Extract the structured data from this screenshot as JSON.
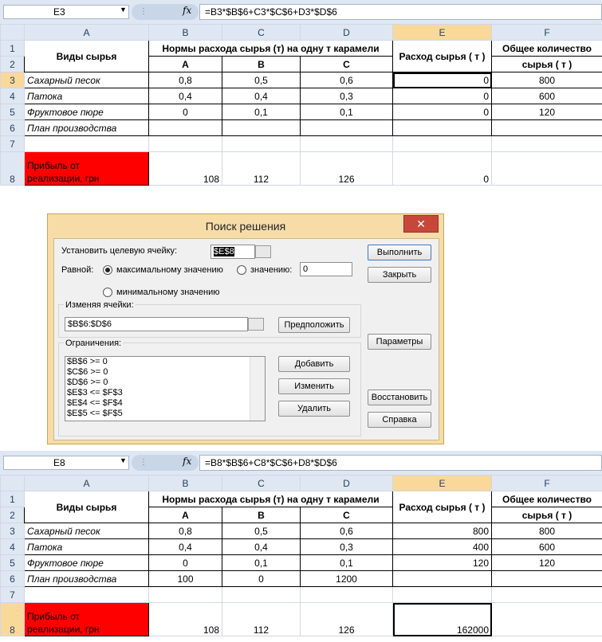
{
  "top": {
    "namebox": "E3",
    "fx": "fx",
    "formula": "=B3*$B$6+C3*$C$6+D3*$D$6"
  },
  "bottom": {
    "namebox": "E8",
    "fx": "fx",
    "formula": "=B8*$B$6+C8*$C$6+D8*$D$6"
  },
  "columns": [
    "A",
    "B",
    "C",
    "D",
    "E",
    "F"
  ],
  "rows": [
    "1",
    "2",
    "3",
    "4",
    "5",
    "6",
    "7",
    "8"
  ],
  "table": {
    "h_types": "Виды сырья",
    "h_norms": "Нормы расхода сырья (т) на одну т карамели",
    "h_a": "A",
    "h_b": "B",
    "h_c": "C",
    "h_usage": "Расход сырья ( т )",
    "h_total1": "Общее количество",
    "h_total2": "сырья ( т )",
    "r3": "Сахарный песок",
    "r4": "Патока",
    "r5": "Фруктовое пюре",
    "r6": "План производства",
    "r8a": "Прибыль от",
    "r8b": "реализации, грн"
  },
  "sheet1": {
    "b3": "0,8",
    "c3": "0,5",
    "d3": "0,6",
    "e3": "0",
    "f3": "800",
    "b4": "0,4",
    "c4": "0,4",
    "d4": "0,3",
    "e4": "0",
    "f4": "600",
    "b5": "0",
    "c5": "0,1",
    "d5": "0,1",
    "e5": "0",
    "f5": "120",
    "b6": "",
    "c6": "",
    "d6": "",
    "b8": "108",
    "c8": "112",
    "d8": "126",
    "e8": "0"
  },
  "sheet2": {
    "b3": "0,8",
    "c3": "0,5",
    "d3": "0,6",
    "e3": "800",
    "f3": "800",
    "b4": "0,4",
    "c4": "0,4",
    "d4": "0,3",
    "e4": "400",
    "f4": "600",
    "b5": "0",
    "c5": "0,1",
    "d5": "0,1",
    "e5": "120",
    "f5": "120",
    "b6": "100",
    "c6": "0",
    "d6": "1200",
    "b8": "108",
    "c8": "112",
    "d8": "126",
    "e8": "162000"
  },
  "dialog": {
    "title": "Поиск решения",
    "close": "✕",
    "target_label": "Установить целевую ячейку:",
    "target_value": "$E$8",
    "equal_label": "Равной:",
    "opt_max": "максимальному значению",
    "opt_value": "значению:",
    "value_field": "0",
    "opt_min": "минимальному значению",
    "changing_label": "Изменяя ячейки:",
    "changing_value": "$B$6:$D$6",
    "guess": "Предположить",
    "constraints_label": "Ограничения:",
    "constraints": [
      "$B$6 >= 0",
      "$C$6 >= 0",
      "$D$6 >= 0",
      "$E$3 <= $F$3",
      "$E$4 <= $F$4",
      "$E$5 <= $F$5"
    ],
    "add": "Добавить",
    "change": "Изменить",
    "delete": "Удалить",
    "solve": "Выполнить",
    "close_btn": "Закрыть",
    "options": "Параметры",
    "reset": "Восстановить",
    "help": "Справка"
  }
}
